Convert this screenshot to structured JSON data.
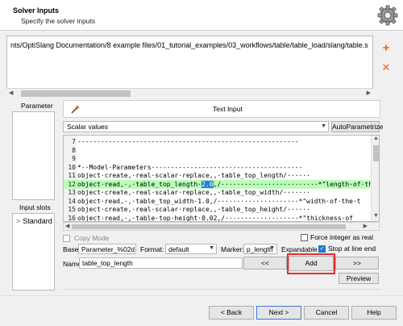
{
  "header": {
    "title": "Solver Inputs",
    "subtitle": "Specify the solver inputs"
  },
  "file_list": {
    "path": "nts/OptiSlang Documentation/8 example files/01_tutorial_examples/03_workflows/table/table_load/slang/table.s"
  },
  "side_buttons": {
    "add": "+",
    "remove": "✕"
  },
  "left_panel": {
    "parameter_label": "Parameter",
    "input_slots_label": "Input slots",
    "slot_item": "Standard"
  },
  "text_input": {
    "tab_label": "Text Input",
    "mode_select": "Scalar values",
    "autoparametrize_label": "AutoParametrize"
  },
  "editor": {
    "lines": [
      {
        "n": "7",
        "pre": "---------------------------------------------------------",
        "post": ""
      },
      {
        "n": "8",
        "pre": "",
        "post": ""
      },
      {
        "n": "9",
        "pre": "",
        "post": ""
      },
      {
        "n": "10",
        "pre": "*-·Model·Parameters·--------------------------------------",
        "post": ""
      },
      {
        "n": "11",
        "pre": "object·create,·real·scalar·replace,,·table_top_length/······",
        "post": ""
      },
      {
        "n": "12",
        "pre": "object·read,·,·table_top_length·",
        "sel": "2.0",
        "post": ",/·························*\"length·of·the·",
        "highlight": true
      },
      {
        "n": "13",
        "pre": "object·create,·real·scalar·replace,,·table_top_width/·······",
        "post": ""
      },
      {
        "n": "14",
        "pre": "object·read,·,·table_top_width·1.0,/·····················*\"width·of·the·t",
        "post": ""
      },
      {
        "n": "15",
        "pre": "object·create,·real·scalar·replace,,·table_top_height/······",
        "post": ""
      },
      {
        "n": "16",
        "pre": "object·read,·,·table·top·height·0.02,/···················*\"thickness·of",
        "post": ""
      }
    ]
  },
  "options": {
    "copy_mode_label": "Copy Mode",
    "force_integer_label": "Force integer as real",
    "base_label": "Base:",
    "base_value": "Parameter_%02d",
    "format_label": "Format:",
    "format_value": "default",
    "marker_label": "Marker:",
    "marker_value": "p_length",
    "expandable_label": "Expandable",
    "stop_at_line_end_label": "Stop at line end",
    "name_label": "Name:",
    "name_value": "table_top_length",
    "prev_label": "<<",
    "next_label": ">>",
    "add_label": "Add",
    "preview_label": "Preview",
    "check_mark": "✓"
  },
  "footer": {
    "back_label": "< Back",
    "next_label": "Next >",
    "cancel_label": "Cancel",
    "help_label": "Help"
  },
  "colors": {
    "accent_orange": "#e8671d",
    "highlight_line": "#b9ffb9",
    "selection": "#2a7fd4",
    "add_highlight": "#e0312f"
  }
}
